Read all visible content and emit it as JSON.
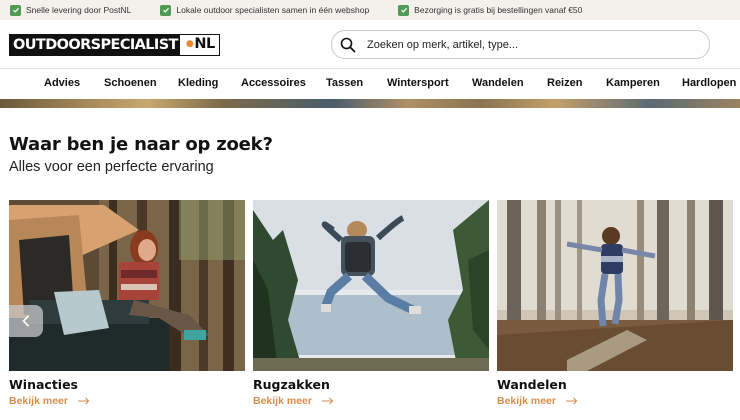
{
  "usp": [
    {
      "text": "Snelle levering door PostNL",
      "icon": "check-icon"
    },
    {
      "text": "Lokale outdoor specialisten samen in één webshop",
      "icon": "check-icon"
    },
    {
      "text": "Bezorging is gratis bij bestellingen vanaf €50",
      "icon": "check-icon"
    }
  ],
  "logo": {
    "main": "OUTDOORSPECIALIST",
    "suffix": "NL"
  },
  "search": {
    "placeholder": "Zoeken op merk, artikel, type...",
    "icon": "search-icon"
  },
  "nav": [
    "Advies",
    "Schoenen",
    "Kleding",
    "Accessoires",
    "Tassen",
    "Wintersport",
    "Wandelen",
    "Reizen",
    "Kamperen",
    "Hardlopen"
  ],
  "section": {
    "title": "Waar ben je naar op zoek?",
    "subtitle": "Alles voor een perfecte ervaring"
  },
  "cards": [
    {
      "title": "Winacties",
      "link": "Bekijk meer"
    },
    {
      "title": "Rugzakken",
      "link": "Bekijk meer"
    },
    {
      "title": "Wandelen",
      "link": "Bekijk meer"
    }
  ],
  "colors": {
    "accent": "#d98e4a",
    "check": "#4f9a55",
    "usp_bg": "#f4f1ec"
  }
}
